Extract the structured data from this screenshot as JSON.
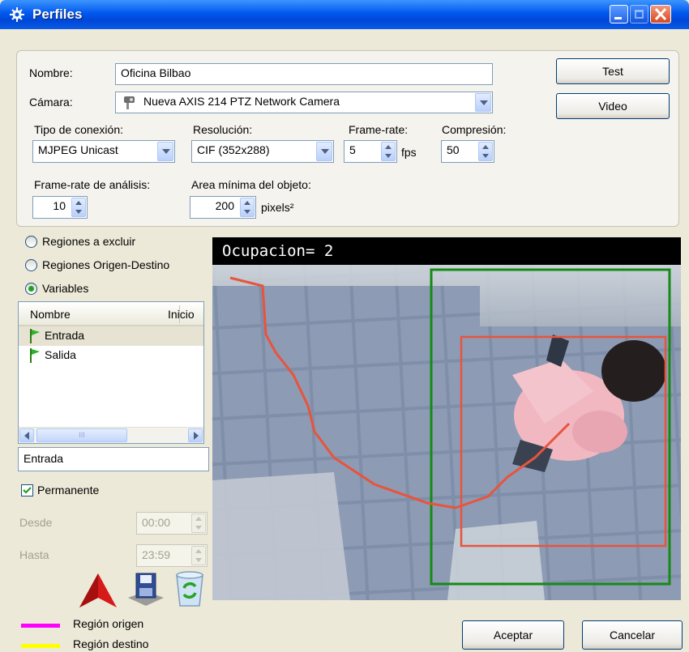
{
  "window": {
    "title": "Perfiles"
  },
  "form": {
    "nombre_label": "Nombre:",
    "nombre_value": "Oficina Bilbao",
    "camara_label": "Cámara:",
    "camara_value": "Nueva AXIS 214 PTZ Network Camera",
    "tipo_conexion_label": "Tipo de conexión:",
    "tipo_conexion_value": "MJPEG Unicast",
    "resolucion_label": "Resolución:",
    "resolucion_value": "CIF (352x288)",
    "framerate_label": "Frame-rate:",
    "framerate_value": "5",
    "framerate_unit": "fps",
    "compresion_label": "Compresión:",
    "compresion_value": "50",
    "framerate_analisis_label": "Frame-rate de análisis:",
    "framerate_analisis_value": "10",
    "area_minima_label": "Area mínima del objeto:",
    "area_minima_value": "200",
    "area_minima_unit": "pixels²"
  },
  "buttons": {
    "test": "Test",
    "video": "Video",
    "aceptar": "Aceptar",
    "cancelar": "Cancelar"
  },
  "modes": {
    "regiones_excluir": "Regiones a excluir",
    "regiones_origen_destino": "Regiones Origen-Destino",
    "variables": "Variables",
    "selected": "Variables"
  },
  "variables_list": {
    "columns": [
      "Nombre",
      "Inicio"
    ],
    "items": [
      {
        "name": "Entrada",
        "icon": "green-flag-icon",
        "selected": true
      },
      {
        "name": "Salida",
        "icon": "green-flag-icon",
        "selected": false
      }
    ],
    "scroll_thumb_label": "III"
  },
  "variable_editor": {
    "name_value": "Entrada",
    "permanente_label": "Permanente",
    "permanente_checked": true,
    "desde_label": "Desde",
    "desde_value": "00:00",
    "hasta_label": "Hasta",
    "hasta_value": "23:59"
  },
  "video": {
    "overlay_text": "Ocupacion= 2"
  },
  "legend": [
    {
      "label": "Región origen",
      "color": "#ff00ff"
    },
    {
      "label": "Región destino",
      "color": "#ffff00"
    }
  ],
  "colors": {
    "track": "#e8543c",
    "box_outer": "#168a16",
    "box_inner": "#e8543c",
    "title_bar": "#0058ee"
  }
}
